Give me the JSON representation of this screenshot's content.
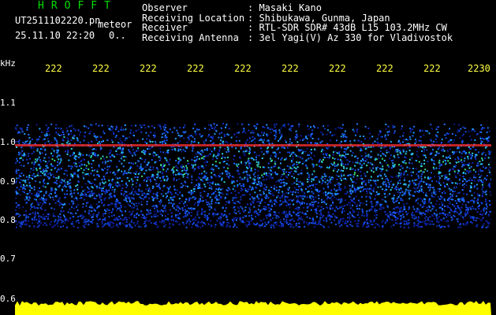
{
  "header": {
    "logo": "HROFFT",
    "filename": "UT2511102220.pn",
    "file_type": "meteor",
    "datetime": "25.11.10 22:20",
    "value": "0..",
    "rows": [
      {
        "label": "Observer",
        "value": ": Masaki Kano"
      },
      {
        "label": "Receiving Location",
        "value": ": Shibukawa, Gunma, Japan"
      },
      {
        "label": "Receiver",
        "value": ": RTL-SDR SDR# 43dB L15 103.2MHz CW"
      },
      {
        "label": "Receiving Antenna",
        "value": ": 3el Yagi(V) Az 330 for Vladivostok"
      }
    ]
  },
  "y_axis": {
    "unit": "kHz",
    "ticks": [
      "1.1",
      "1.0",
      "0.9",
      "0.8",
      "0.7",
      "0.6"
    ]
  },
  "x_axis": {
    "ticks": [
      "222",
      "222",
      "222",
      "222",
      "222",
      "222",
      "222",
      "222",
      "222",
      "2230"
    ]
  },
  "colors": {
    "logo": "#00e000",
    "tick_labels": "#ffff40",
    "signal_line": "#ff3030",
    "noise_floor": "#1040ff",
    "amplitude": "#ffff00"
  }
}
